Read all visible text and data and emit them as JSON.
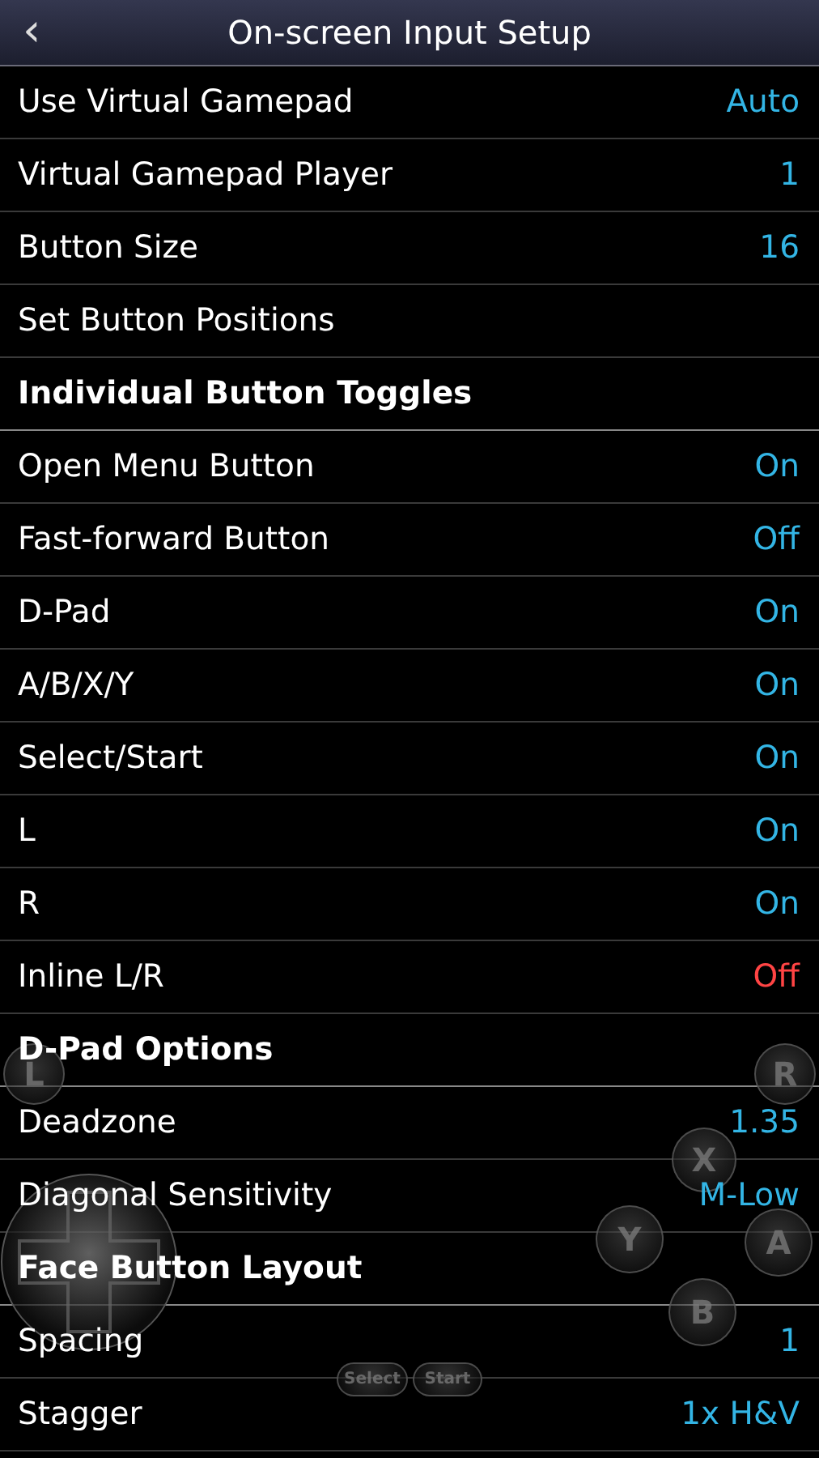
{
  "title_bar": {
    "back": "‹",
    "title": "On-screen Input Setup"
  },
  "rows": [
    {
      "kind": "setting",
      "label": "Use Virtual Gamepad",
      "value": "Auto",
      "color": "#33b5e5"
    },
    {
      "kind": "setting",
      "label": "Virtual Gamepad Player",
      "value": "1",
      "color": "#33b5e5"
    },
    {
      "kind": "setting",
      "label": "Button Size",
      "value": "16",
      "color": "#33b5e5"
    },
    {
      "kind": "setting",
      "label": "Set Button Positions"
    },
    {
      "kind": "header",
      "label": "Individual Button Toggles"
    },
    {
      "kind": "setting",
      "label": "Open Menu Button",
      "value": "On",
      "color": "#33b5e5"
    },
    {
      "kind": "setting",
      "label": "Fast-forward Button",
      "value": "Off",
      "color": "#33b5e5"
    },
    {
      "kind": "setting",
      "label": "D-Pad",
      "value": "On",
      "color": "#33b5e5"
    },
    {
      "kind": "setting",
      "label": "A/B/X/Y",
      "value": "On",
      "color": "#33b5e5"
    },
    {
      "kind": "setting",
      "label": "Select/Start",
      "value": "On",
      "color": "#33b5e5"
    },
    {
      "kind": "setting",
      "label": "L",
      "value": "On",
      "color": "#33b5e5"
    },
    {
      "kind": "setting",
      "label": "R",
      "value": "On",
      "color": "#33b5e5"
    },
    {
      "kind": "setting",
      "label": "Inline L/R",
      "value": "Off",
      "color": "#ff4444"
    },
    {
      "kind": "header",
      "label": "D-Pad Options"
    },
    {
      "kind": "setting",
      "label": "Deadzone",
      "value": "1.35",
      "color": "#33b5e5"
    },
    {
      "kind": "setting",
      "label": "Diagonal Sensitivity",
      "value": "M-Low",
      "color": "#33b5e5"
    },
    {
      "kind": "header",
      "label": "Face Button Layout"
    },
    {
      "kind": "setting",
      "label": "Spacing",
      "value": "1",
      "color": "#33b5e5"
    },
    {
      "kind": "setting",
      "label": "Stagger",
      "value": "1x H&V",
      "color": "#33b5e5"
    }
  ],
  "gamepad_overlay": [
    {
      "kind": "shoulder",
      "label": "L"
    },
    {
      "kind": "shoulder",
      "label": "R"
    },
    {
      "kind": "face",
      "label": "X"
    },
    {
      "kind": "face",
      "label": "Y"
    },
    {
      "kind": "face",
      "label": "A"
    },
    {
      "kind": "face",
      "label": "B"
    },
    {
      "kind": "pill",
      "label": "Select"
    },
    {
      "kind": "pill",
      "label": "Start"
    },
    {
      "kind": "dpad"
    }
  ]
}
